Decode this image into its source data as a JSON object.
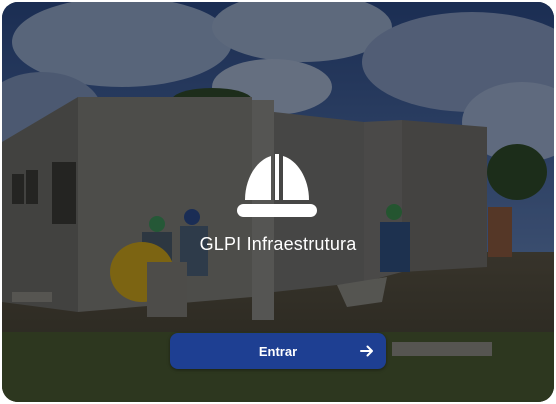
{
  "app": {
    "title": "GLPI Infraestrutura",
    "logo_icon": "hard-hat-icon"
  },
  "login": {
    "button_label": "Entrar",
    "button_icon": "arrow-right-icon"
  },
  "background": {
    "description_icon": "construction-site-photo"
  },
  "colors": {
    "button": "#1e3f92",
    "text": "#ffffff"
  }
}
